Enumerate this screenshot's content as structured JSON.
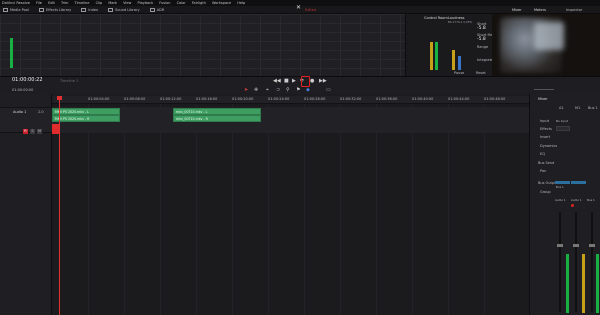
{
  "menubar": [
    "DaVinci Resolve",
    "File",
    "Edit",
    "Trim",
    "Timeline",
    "Clip",
    "Mark",
    "View",
    "Playback",
    "Fusion",
    "Color",
    "Fairlight",
    "Workspace",
    "Help"
  ],
  "toolbar": {
    "left_buttons": [
      "Media Pool",
      "Effects Library",
      "Index",
      "Sound Library",
      "ADR"
    ],
    "center_icon": "close-icon",
    "center_label": "Edited",
    "right_buttons": [
      "Mixer",
      "Meters",
      "Inspector"
    ]
  },
  "loudness": {
    "bus_label": "Bus 1",
    "control_room_label": "Control Room",
    "loudness_label": "Loudness",
    "standard": "BS.1770-1 (LUFS)",
    "short_label": "Short",
    "short_value": "-5.8",
    "short_max_label": "Short Max",
    "short_max_value": "-5.8",
    "range_label": "Range",
    "integrated_label": "Integrated",
    "pause_label": "Pause",
    "reset_label": "Reset"
  },
  "timecode": "01:00:00:22",
  "timeline_name": "Timeline 1",
  "track": {
    "name": "Audio 1",
    "level": "2.0",
    "buttons": [
      "R",
      "S",
      "M"
    ]
  },
  "ruler_labels": [
    "01:00:00:00",
    "01:00:04:00",
    "01:00:08:00",
    "01:00:12:00",
    "01:00:16:00",
    "01:00:20:00",
    "01:00:24:00",
    "01:00:28:00",
    "01:00:32:00",
    "01:00:36:00",
    "01:00:40:00",
    "01:00:44:00",
    "01:00:48:00",
    "01:00:52:00",
    "01:00:56:00",
    "01:01:00:00"
  ],
  "clips": [
    {
      "label": "MKV P5 2020.mkv - L"
    },
    {
      "label": "MKV P5 2020.mkv - R"
    },
    {
      "label": "mkv_00710.mkv - L"
    },
    {
      "label": "mkv_00710.mkv - R"
    }
  ],
  "mixer": {
    "title": "Mixer",
    "strips": [
      {
        "name": "A1",
        "bottom": "Audio 1"
      },
      {
        "name": "M1",
        "bottom": "Audio 1"
      },
      {
        "name": "Bus 1",
        "bottom": "Bus 1"
      }
    ],
    "rows": [
      "Input",
      "Effects",
      "Insert",
      "Dynamics",
      "EQ",
      "Bus Send",
      "Pan",
      "Bus Outputs",
      "Group"
    ],
    "input_value": "No Input",
    "bus_output": "Bus 1"
  },
  "colors": {
    "accent": "#19b043",
    "highlight": "#e02020",
    "clip": "#3e9e62"
  }
}
